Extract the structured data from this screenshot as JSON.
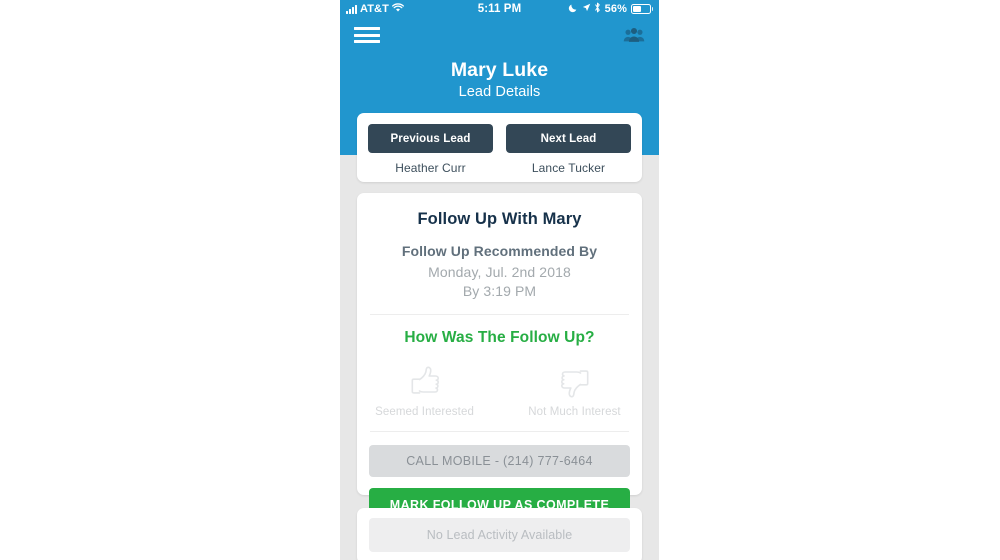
{
  "status_bar": {
    "carrier": "AT&T",
    "time": "5:11 PM",
    "battery_percent": "56%",
    "icons": [
      "signal-bars-icon",
      "wifi-icon",
      "do-not-disturb-moon-icon",
      "location-arrow-icon",
      "bluetooth-icon",
      "battery-icon"
    ]
  },
  "header": {
    "menu_icon": "hamburger-menu-icon",
    "contacts_icon": "people-group-icon",
    "title": "Mary Luke",
    "subtitle": "Lead Details",
    "background_color": "#2196ce"
  },
  "lead_nav": {
    "previous": {
      "button_label": "Previous Lead",
      "lead_name": "Heather Curr"
    },
    "next": {
      "button_label": "Next Lead",
      "lead_name": "Lance Tucker"
    },
    "button_color": "#334756"
  },
  "follow_up": {
    "title": "Follow Up With Mary",
    "recommended_label": "Follow Up Recommended By",
    "recommended_date": "Monday, Jul. 2nd 2018",
    "recommended_time": "By 3:19 PM",
    "question": "How Was The Follow Up?",
    "question_color": "#27ae44",
    "options": [
      {
        "icon": "thumbs-up-icon",
        "label": "Seemed Interested"
      },
      {
        "icon": "thumbs-down-icon",
        "label": "Not Much Interest"
      }
    ],
    "call_button_label": "CALL MOBILE - (214) 777-6464",
    "complete_button_label": "MARK FOLLOW UP AS COMPLETE",
    "complete_button_color": "#27ae44"
  },
  "activity": {
    "empty_message": "No Lead Activity Available"
  }
}
